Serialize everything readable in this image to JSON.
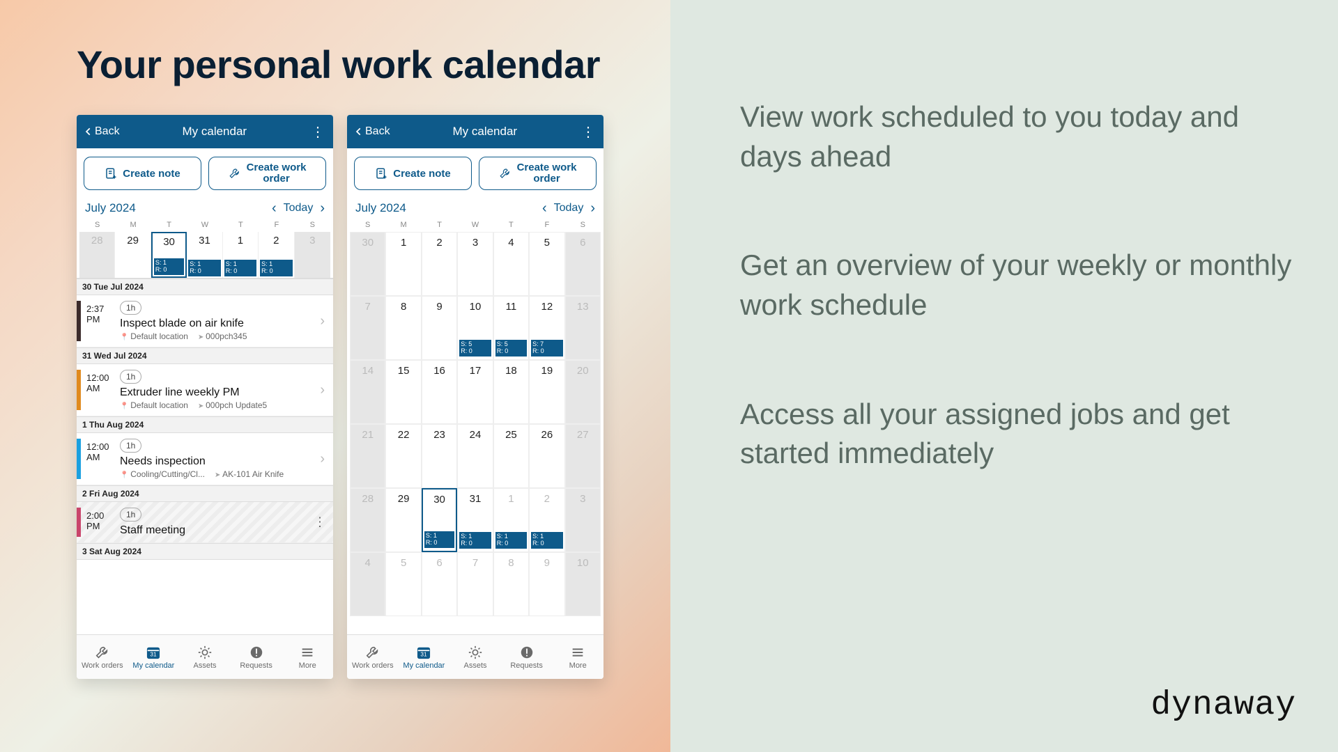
{
  "heading": "Your personal work calendar",
  "bullets": [
    "View work scheduled to you today and days ahead",
    "Get an overview of your weekly or monthly work schedule",
    "Access all your assigned jobs and get started immediately"
  ],
  "brand": "dynaway",
  "appbar": {
    "back": "Back",
    "title": "My calendar"
  },
  "actions": {
    "create_note": "Create note",
    "create_work_order": "Create work\norder"
  },
  "month_label": "July  2024",
  "today_label": "Today",
  "dow": [
    "S",
    "M",
    "T",
    "W",
    "T",
    "F",
    "S"
  ],
  "phoneA": {
    "week": [
      {
        "n": "28",
        "dis": true,
        "weekend": true
      },
      {
        "n": "29"
      },
      {
        "n": "30",
        "sel": true,
        "tag": "S: 1\nR: 0"
      },
      {
        "n": "31",
        "tag": "S: 1\nR: 0"
      },
      {
        "n": "1",
        "tag": "S: 1\nR: 0"
      },
      {
        "n": "2",
        "tag": "S: 1\nR: 0"
      },
      {
        "n": "3",
        "dis": true,
        "weekend": true
      }
    ],
    "events": [
      {
        "hdr": "30 Tue Jul 2024"
      },
      {
        "color": "#3b2b2b",
        "time": "2:37 PM",
        "dur": "1h",
        "title": "Inspect blade on air knife",
        "loc": "Default location",
        "asset": "000pch345",
        "chev": true
      },
      {
        "hdr": "31 Wed Jul 2024"
      },
      {
        "color": "#e08a1e",
        "time": "12:00 AM",
        "dur": "1h",
        "title": "Extruder line weekly PM",
        "loc": "Default location",
        "asset": "000pch Update5",
        "chev": true
      },
      {
        "hdr": "1 Thu Aug 2024"
      },
      {
        "color": "#1aa0e0",
        "time": "12:00 AM",
        "dur": "1h",
        "title": "Needs inspection",
        "loc": "Cooling/Cutting/Cl...",
        "asset": "AK-101 Air Knife",
        "chev": true
      },
      {
        "hdr": "2 Fri Aug 2024"
      },
      {
        "color": "#c9446b",
        "time": "2:00 PM",
        "dur": "1h",
        "title": "Staff meeting",
        "hatched": true,
        "dots": true
      },
      {
        "hdr": "3 Sat Aug 2024"
      }
    ]
  },
  "phoneB": {
    "grid": [
      [
        {
          "n": "30",
          "dis": true,
          "weekend": true
        },
        {
          "n": "1"
        },
        {
          "n": "2"
        },
        {
          "n": "3"
        },
        {
          "n": "4"
        },
        {
          "n": "5"
        },
        {
          "n": "6",
          "dis": true,
          "weekend": true
        }
      ],
      [
        {
          "n": "7",
          "dis": true,
          "weekend": true
        },
        {
          "n": "8"
        },
        {
          "n": "9"
        },
        {
          "n": "10",
          "tag": "S: 5\nR: 0"
        },
        {
          "n": "11",
          "tag": "S: 5\nR: 0"
        },
        {
          "n": "12",
          "tag": "S: 7\nR: 0"
        },
        {
          "n": "13",
          "dis": true,
          "weekend": true
        }
      ],
      [
        {
          "n": "14",
          "dis": true,
          "weekend": true
        },
        {
          "n": "15"
        },
        {
          "n": "16"
        },
        {
          "n": "17"
        },
        {
          "n": "18"
        },
        {
          "n": "19"
        },
        {
          "n": "20",
          "dis": true,
          "weekend": true
        }
      ],
      [
        {
          "n": "21",
          "dis": true,
          "weekend": true
        },
        {
          "n": "22"
        },
        {
          "n": "23"
        },
        {
          "n": "24"
        },
        {
          "n": "25"
        },
        {
          "n": "26"
        },
        {
          "n": "27",
          "dis": true,
          "weekend": true
        }
      ],
      [
        {
          "n": "28",
          "dis": true,
          "weekend": true
        },
        {
          "n": "29"
        },
        {
          "n": "30",
          "sel": true,
          "tag": "S: 1\nR: 0"
        },
        {
          "n": "31",
          "tag": "S: 1\nR: 0"
        },
        {
          "n": "1",
          "dis": true,
          "tag": "S: 1\nR: 0"
        },
        {
          "n": "2",
          "dis": true,
          "tag": "S: 1\nR: 0"
        },
        {
          "n": "3",
          "dis": true,
          "weekend": true
        }
      ],
      [
        {
          "n": "4",
          "dis": true,
          "weekend": true
        },
        {
          "n": "5",
          "dis": true
        },
        {
          "n": "6",
          "dis": true
        },
        {
          "n": "7",
          "dis": true
        },
        {
          "n": "8",
          "dis": true
        },
        {
          "n": "9",
          "dis": true
        },
        {
          "n": "10",
          "dis": true,
          "weekend": true
        }
      ]
    ]
  },
  "tabs": [
    {
      "label": "Work orders",
      "icon": "wrench"
    },
    {
      "label": "My calendar",
      "icon": "calendar",
      "active": true
    },
    {
      "label": "Assets",
      "icon": "gear"
    },
    {
      "label": "Requests",
      "icon": "alert"
    },
    {
      "label": "More",
      "icon": "menu"
    }
  ]
}
